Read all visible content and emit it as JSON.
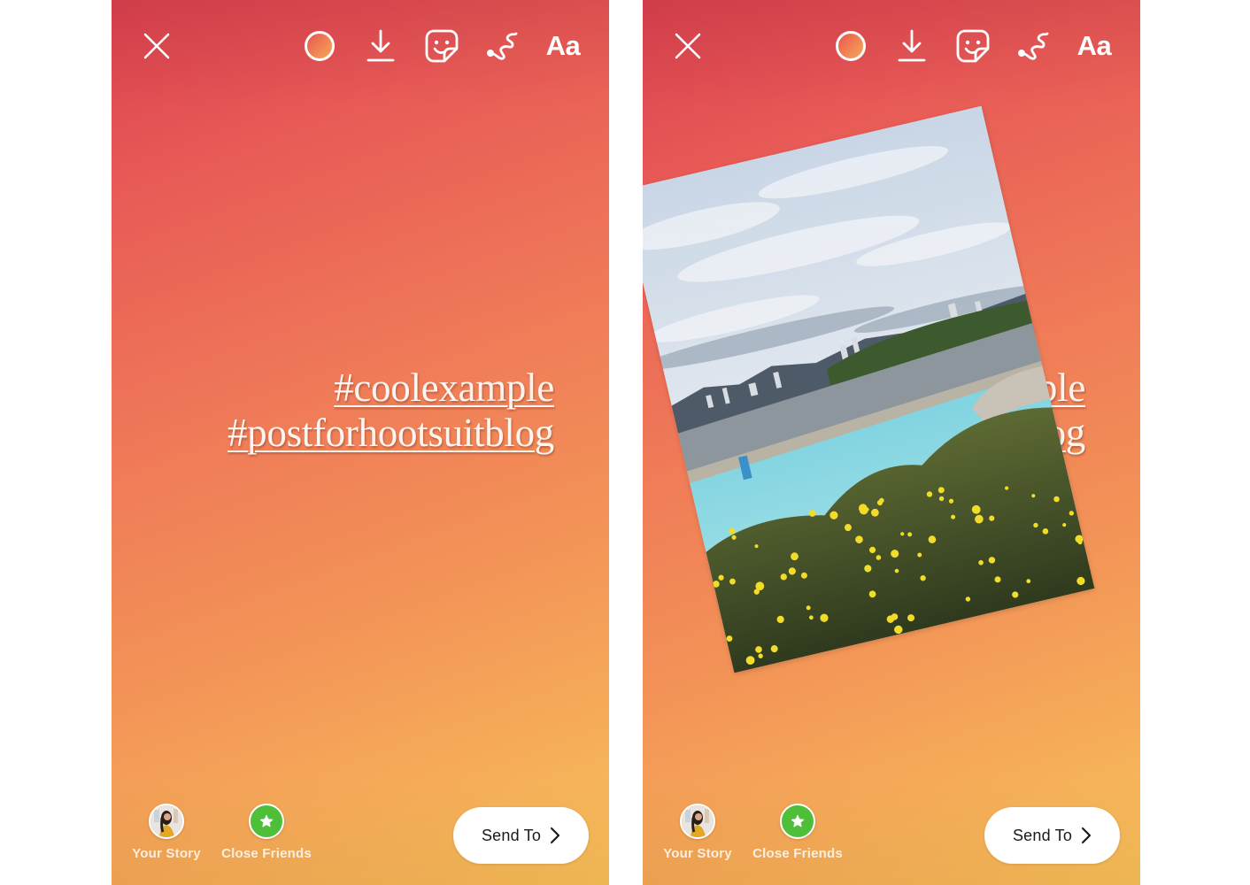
{
  "screens": [
    {
      "id": "left",
      "toolbar": {
        "close_icon": "close-x-icon",
        "color_icon": "color-picker-circle-icon",
        "save_icon": "download-icon",
        "sticker_icon": "sticker-face-icon",
        "draw_icon": "draw-squiggle-icon",
        "text_label": "Aa"
      },
      "caption": {
        "lines": [
          "#coolexample",
          "#postforhootsuitblog"
        ]
      },
      "has_photo": false,
      "bottom": {
        "your_story_label": "Your Story",
        "close_friends_label": "Close Friends",
        "send_label": "Send To"
      }
    },
    {
      "id": "right",
      "toolbar": {
        "close_icon": "close-x-icon",
        "color_icon": "color-picker-circle-icon",
        "save_icon": "download-icon",
        "sticker_icon": "sticker-face-icon",
        "draw_icon": "draw-squiggle-icon",
        "text_label": "Aa"
      },
      "caption": {
        "lines": [
          "#coolexample",
          "#postforhootsuitblog"
        ]
      },
      "has_photo": true,
      "photo": {
        "description": "Outdoor pool with city skyline, mountains and yellow flowering shrubs"
      },
      "bottom": {
        "your_story_label": "Your Story",
        "close_friends_label": "Close Friends",
        "send_label": "Send To"
      }
    }
  ],
  "colors": {
    "gradient_top": "#d9414f",
    "gradient_bottom": "#f8c25a",
    "close_friends_green": "#4fbf3a",
    "send_button_bg": "#ffffff"
  }
}
